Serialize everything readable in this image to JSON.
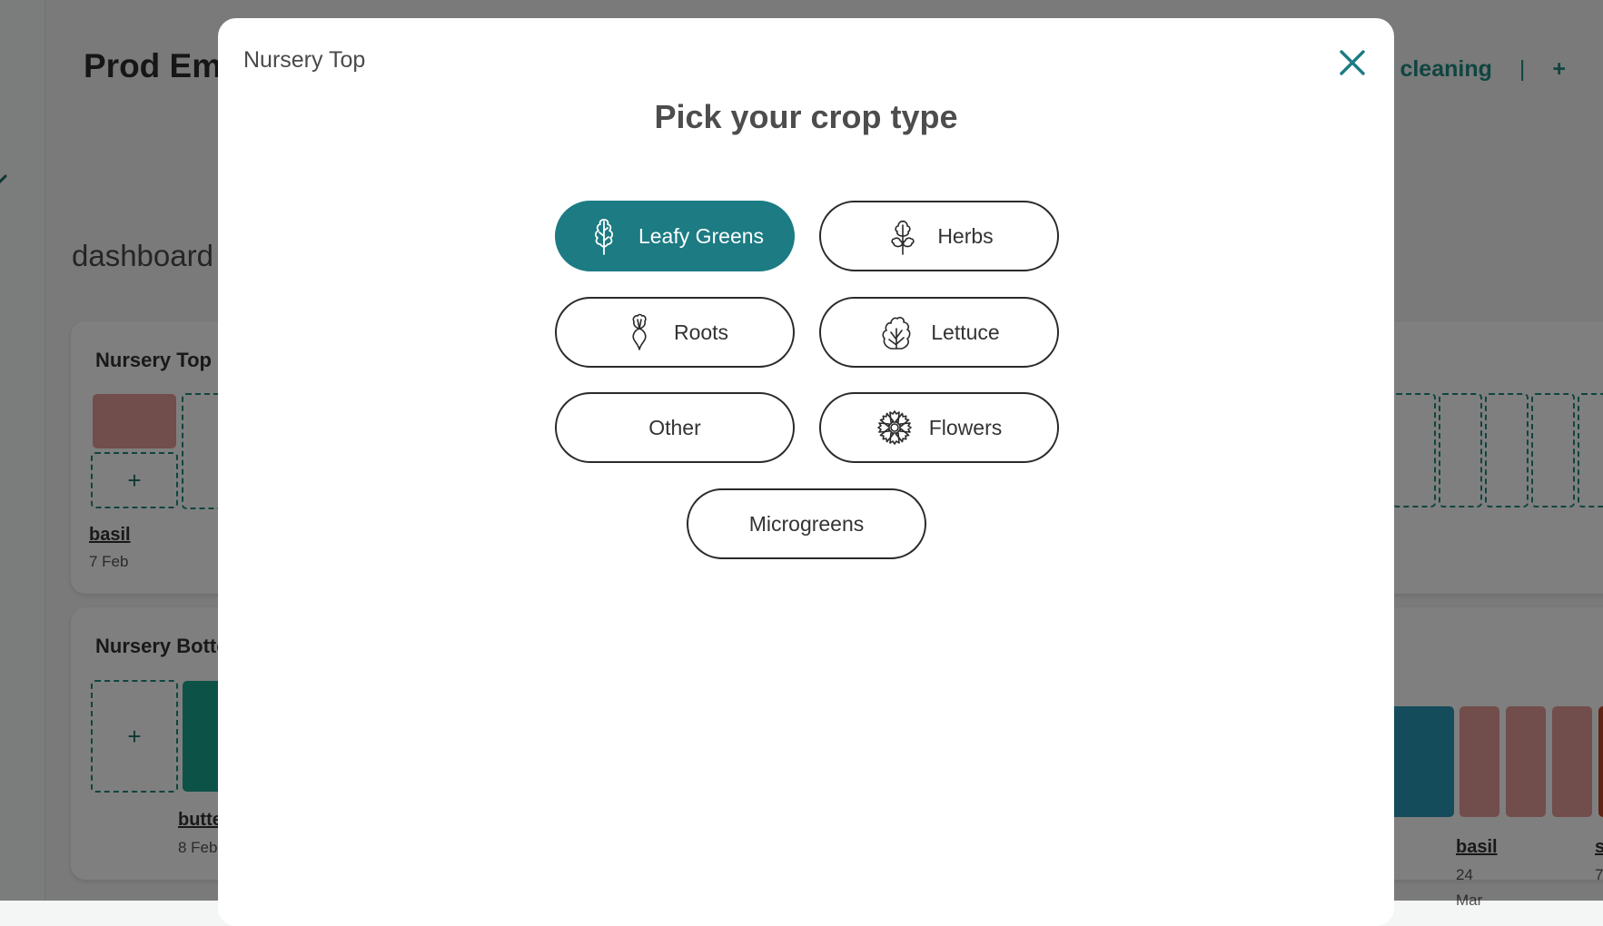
{
  "app": {
    "title": "Prod Emulator",
    "section_label": "dashboard",
    "top_actions": [
      "Nursery cleaning",
      "|",
      "+"
    ]
  },
  "background_cards": {
    "nursery_top": {
      "title": "Nursery Top",
      "crop_name": "basil",
      "crop_date": "7 Feb",
      "add_symbol": "+"
    },
    "nursery_bottom": {
      "title": "Nursery Bottom",
      "crop_name": "butterhead",
      "crop_date": "8 Feb",
      "add_symbol": "+"
    },
    "right_bottom": {
      "crop_name": "basil",
      "crop_date_day": "24",
      "crop_date_month": "Mar",
      "next_crop_initial": "s",
      "next_crop_date": "7"
    }
  },
  "colors": {
    "accent": "#1c7b83",
    "slot_basil": "#e39a96",
    "slot_teal": "#1aa58f",
    "slot_blue": "#2b98b8",
    "slot_rust": "#c0482f"
  },
  "modal": {
    "context_label": "Nursery Top",
    "title": "Pick your crop type",
    "close_icon": "close-icon",
    "selected": "Leafy Greens",
    "options": [
      {
        "label": "Leafy Greens",
        "icon": "leaf-icon",
        "selected": true
      },
      {
        "label": "Herbs",
        "icon": "herb-icon",
        "selected": false
      },
      {
        "label": "Roots",
        "icon": "radish-icon",
        "selected": false
      },
      {
        "label": "Lettuce",
        "icon": "lettuce-icon",
        "selected": false
      },
      {
        "label": "Other",
        "icon": null,
        "selected": false
      },
      {
        "label": "Flowers",
        "icon": "flower-icon",
        "selected": false
      },
      {
        "label": "Microgreens",
        "icon": null,
        "selected": false
      }
    ]
  }
}
